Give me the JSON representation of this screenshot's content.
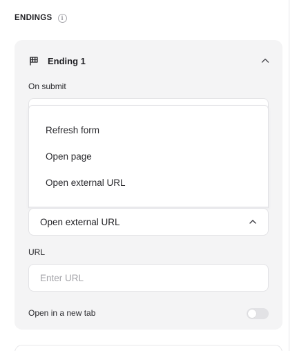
{
  "section": {
    "title": "ENDINGS",
    "info_icon": "info-icon"
  },
  "ending": {
    "title": "Ending 1",
    "icon": "flag-icon",
    "on_submit_label": "On submit",
    "dropdown": {
      "options": [
        "Refresh form",
        "Open page",
        "Open external URL"
      ],
      "selected": "Open external URL",
      "expanded": true
    },
    "url_label": "URL",
    "url_placeholder": "Enter URL",
    "new_tab_label": "Open in a new tab",
    "new_tab_enabled": false
  }
}
